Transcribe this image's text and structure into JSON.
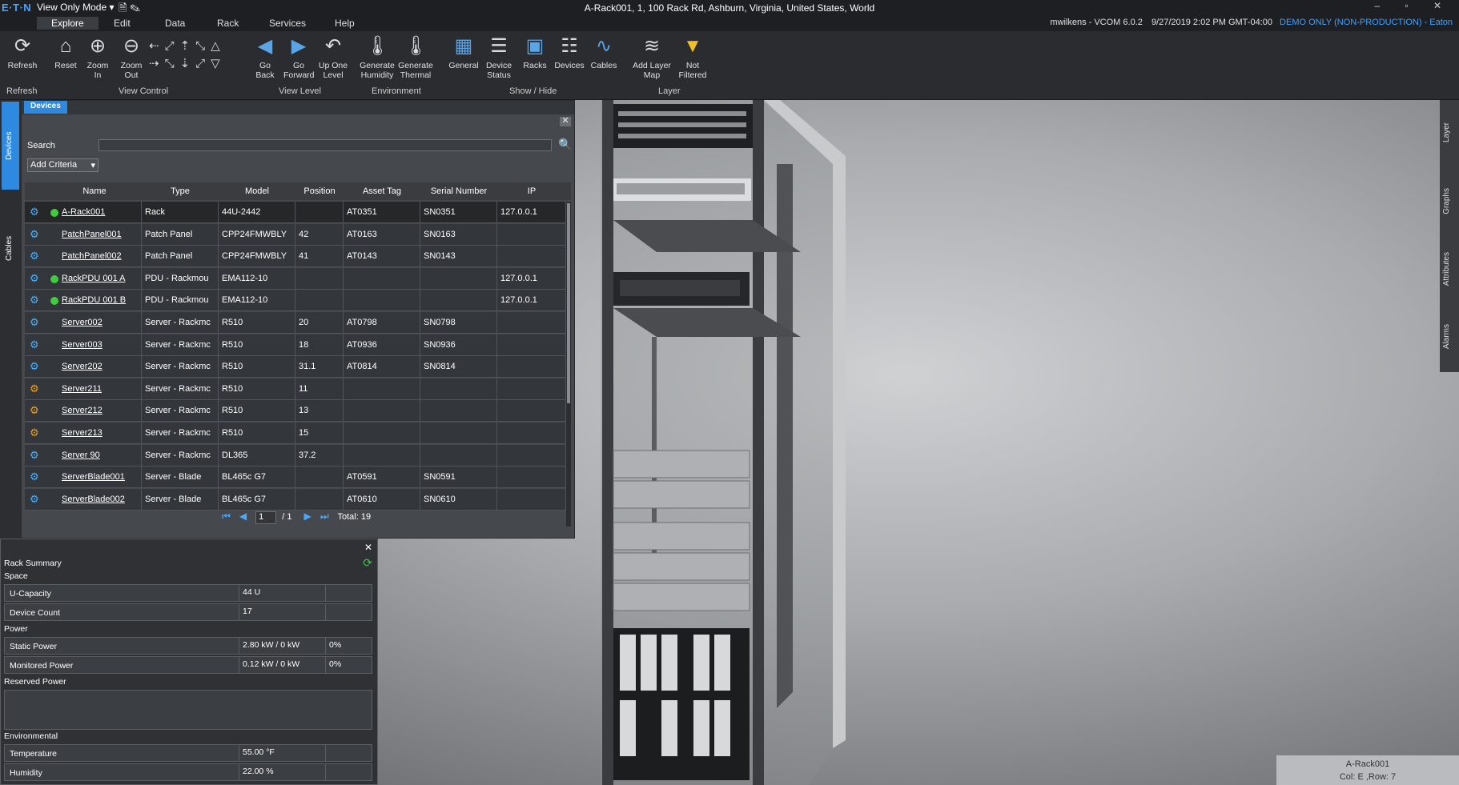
{
  "titlebar": {
    "logo": "E·T·N",
    "mode": "View Only Mode ▾",
    "title": "A-Rack001, 1, 100 Rack Rd, Ashburn, Virginia, United States, World",
    "window_controls": "–  ▫  ✕"
  },
  "menu": {
    "items": [
      "Explore",
      "Edit",
      "Data",
      "Rack",
      "Services",
      "Help"
    ],
    "user": "mwilkens - VCOM 6.0.2",
    "datetime": "9/27/2019 2:02 PM GMT-04:00",
    "demo": "DEMO ONLY (NON-PRODUCTION) - Eaton"
  },
  "ribbon": {
    "refresh": "Refresh",
    "reset": "Reset",
    "zoom_in": "Zoom In",
    "zoom_out": "Zoom Out",
    "go_back": "Go Back",
    "go_forward": "Go Forward",
    "up_one_level": "Up One Level",
    "gen_humidity": "Generate Humidity",
    "gen_thermal": "Generate Thermal",
    "general": "General",
    "device_status": "Device Status",
    "racks": "Racks",
    "devices": "Devices",
    "cables": "Cables",
    "add_layer_map": "Add Layer Map",
    "not_filtered": "Not Filtered",
    "groups": {
      "refresh": "Refresh",
      "view_control": "View Control",
      "view_level": "View Level",
      "environment": "Environment",
      "show_hide": "Show / Hide",
      "layer": "Layer"
    }
  },
  "left_tabs": [
    "Devices",
    "Cables"
  ],
  "right_tabs": [
    "Layer",
    "Graphs",
    "Attributes",
    "Alarms"
  ],
  "devices_panel": {
    "tab": "Devices",
    "search_label": "Search",
    "search_value": "",
    "add_criteria": "Add Criteria",
    "columns": [
      "Name",
      "Type",
      "Model",
      "Position",
      "Asset Tag",
      "Serial Number",
      "IP"
    ],
    "rows": [
      {
        "name": "A-Rack001",
        "type": "Rack",
        "model": "44U-2442",
        "position": "",
        "asset": "AT0351",
        "serial": "SN0351",
        "ip": "127.0.0.1",
        "status": true
      },
      {
        "name": "PatchPanel001",
        "type": "Patch Panel",
        "model": "CPP24FMWBLY",
        "position": "42",
        "asset": "AT0163",
        "serial": "SN0163",
        "ip": "",
        "status": false
      },
      {
        "name": "PatchPanel002",
        "type": "Patch Panel",
        "model": "CPP24FMWBLY",
        "position": "41",
        "asset": "AT0143",
        "serial": "SN0143",
        "ip": "",
        "status": false
      },
      {
        "name": "RackPDU 001 A",
        "type": "PDU - Rackmou",
        "model": "EMA112-10",
        "position": "",
        "asset": "",
        "serial": "",
        "ip": "127.0.0.1",
        "status": true
      },
      {
        "name": "RackPDU 001 B",
        "type": "PDU - Rackmou",
        "model": "EMA112-10",
        "position": "",
        "asset": "",
        "serial": "",
        "ip": "127.0.0.1",
        "status": true
      },
      {
        "name": "Server002",
        "type": "Server - Rackmc",
        "model": "R510",
        "position": "20",
        "asset": "AT0798",
        "serial": "SN0798",
        "ip": "",
        "status": false
      },
      {
        "name": "Server003",
        "type": "Server - Rackmc",
        "model": "R510",
        "position": "18",
        "asset": "AT0936",
        "serial": "SN0936",
        "ip": "",
        "status": false
      },
      {
        "name": "Server202",
        "type": "Server - Rackmc",
        "model": "R510",
        "position": "31.1",
        "asset": "AT0814",
        "serial": "SN0814",
        "ip": "",
        "status": false
      },
      {
        "name": "Server211",
        "type": "Server - Rackmc",
        "model": "R510",
        "position": "11",
        "asset": "",
        "serial": "",
        "ip": "",
        "status": false
      },
      {
        "name": "Server212",
        "type": "Server - Rackmc",
        "model": "R510",
        "position": "13",
        "asset": "",
        "serial": "",
        "ip": "",
        "status": false
      },
      {
        "name": "Server213",
        "type": "Server - Rackmc",
        "model": "R510",
        "position": "15",
        "asset": "",
        "serial": "",
        "ip": "",
        "status": false
      },
      {
        "name": "Server 90",
        "type": "Server - Rackmc",
        "model": "DL365",
        "position": "37.2",
        "asset": "",
        "serial": "",
        "ip": "",
        "status": false
      },
      {
        "name": "ServerBlade001",
        "type": "Server - Blade",
        "model": "BL465c G7",
        "position": "",
        "asset": "AT0591",
        "serial": "SN0591",
        "ip": "",
        "status": false
      },
      {
        "name": "ServerBlade002",
        "type": "Server - Blade",
        "model": "BL465c G7",
        "position": "",
        "asset": "AT0610",
        "serial": "SN0610",
        "ip": "",
        "status": false
      }
    ],
    "pager": {
      "page": "1",
      "of": "/ 1",
      "total": "Total: 19"
    }
  },
  "rack_summary": {
    "title": "Rack Summary",
    "space": "Space",
    "u_capacity_label": "U-Capacity",
    "u_capacity": "44 U",
    "device_count_label": "Device Count",
    "device_count": "17",
    "power": "Power",
    "static_power_label": "Static Power",
    "static_power": "2.80 kW / 0 kW",
    "static_power_pct": "0%",
    "monitored_power_label": "Monitored Power",
    "monitored_power": "0.12 kW / 0 kW",
    "monitored_power_pct": "0%",
    "reserved_power": "Reserved Power",
    "environmental": "Environmental",
    "temperature_label": "Temperature",
    "temperature": "55.00 °F",
    "humidity_label": "Humidity",
    "humidity": "22.00 %"
  },
  "location_badge": {
    "name": "A-Rack001",
    "position": "Col: E ,Row: 7"
  }
}
